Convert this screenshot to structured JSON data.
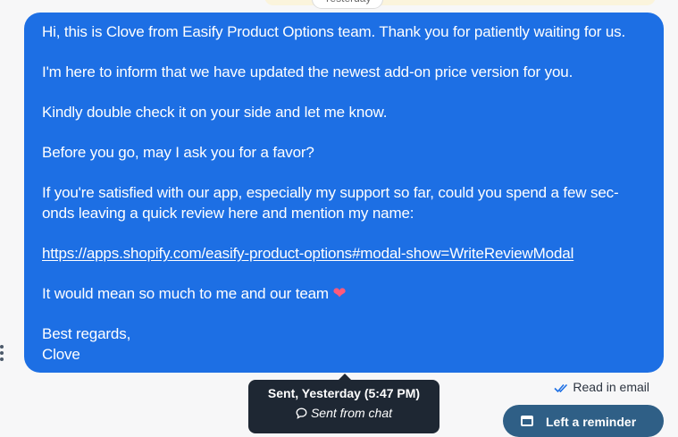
{
  "date_separator": {
    "label": "Yesterday"
  },
  "message": {
    "paragraphs": {
      "greeting": "Hi, this is Clove from Easify Product Options team. Thank you for patiently waiting for us.",
      "update": "I'm here to inform that we have updated the newest add-on price version for you.",
      "check": "Kindly double check it on your side and let me know.",
      "favor": "Before you go, may I ask you for a favor?",
      "review_line1": "If you're satisfied with our app, especially my support so far, could you spend a few sec-",
      "review_line2": "onds leaving a quick review here and mention my name:",
      "link": "https://apps.shopify.com/easify-product-options#modal-show=WriteReviewModal",
      "thanks": "It would mean so much to me and our team",
      "heart": "❤",
      "signoff": "Best regards,",
      "name": "Clove"
    },
    "colors": {
      "bubble": "#1d6fe4",
      "heart": "#ff5a7a"
    }
  },
  "tooltip": {
    "sent": "Sent, Yesterday (5:47 PM)",
    "channel": "Sent from chat"
  },
  "read_status": {
    "label": "Read in email",
    "icon": "double-check-icon"
  },
  "reminder_button": {
    "label": "Left a reminder",
    "icon": "calendar-icon"
  }
}
